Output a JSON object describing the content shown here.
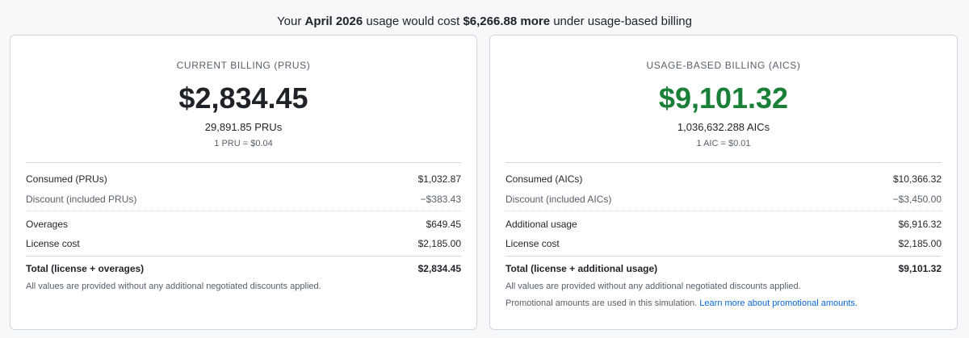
{
  "headline": {
    "prefix": "Your ",
    "month": "April 2026",
    "middle": " usage would cost ",
    "difference": "$6,266.88 more",
    "suffix": " under usage-based billing"
  },
  "current": {
    "title": "CURRENT BILLING (PRUS)",
    "amount": "$2,834.45",
    "units": "29,891.85 PRUs",
    "rate": "1 PRU = $0.04",
    "rows": [
      {
        "label": "Consumed (PRUs)",
        "value": "$1,032.87"
      },
      {
        "label": "Discount (included PRUs)",
        "value": "−$383.43"
      },
      {
        "label": "Overages",
        "value": "$649.45"
      },
      {
        "label": "License cost",
        "value": "$2,185.00"
      },
      {
        "label": "Total (license + overages)",
        "value": "$2,834.45"
      }
    ],
    "note": "All values are provided without any additional negotiated discounts applied."
  },
  "usage": {
    "title": "USAGE-BASED BILLING (AICS)",
    "amount": "$9,101.32",
    "units": "1,036,632.288 AICs",
    "rate": "1 AIC = $0.01",
    "rows": [
      {
        "label": "Consumed (AICs)",
        "value": "$10,366.32"
      },
      {
        "label": "Discount (included AICs)",
        "value": "−$3,450.00"
      },
      {
        "label": "Additional usage",
        "value": "$6,916.32"
      },
      {
        "label": "License cost",
        "value": "$2,185.00"
      },
      {
        "label": "Total (license + additional usage)",
        "value": "$9,101.32"
      }
    ],
    "note": "All values are provided without any additional negotiated discounts applied.",
    "promo_text": "Promotional amounts are used in this simulation. ",
    "promo_link": "Learn more about promotional amounts."
  },
  "colors": {
    "usage_amount": "#1a7f37",
    "link": "#0969da"
  }
}
